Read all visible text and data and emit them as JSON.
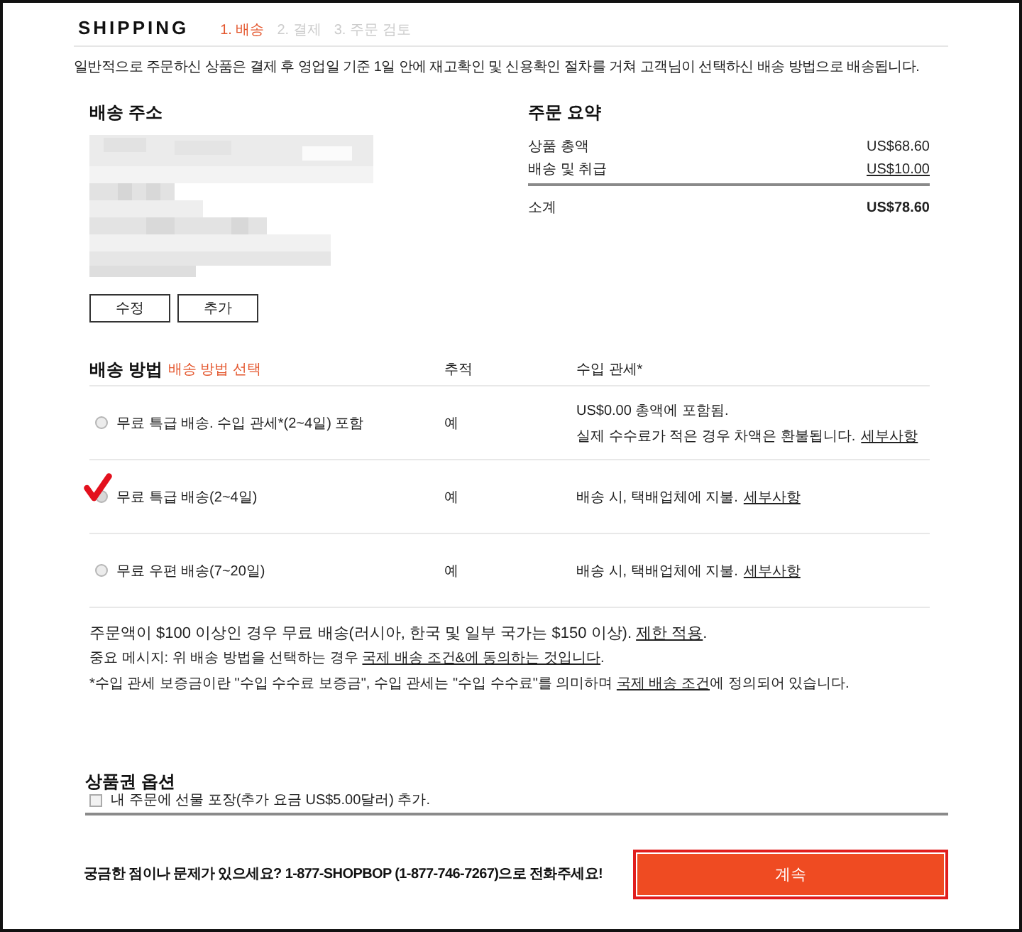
{
  "header": {
    "title": "SHIPPING",
    "steps": [
      {
        "label": "1. 배송",
        "selected": true
      },
      {
        "label": "2. 결제",
        "selected": false
      },
      {
        "label": "3. 주문 검토",
        "selected": false
      }
    ]
  },
  "intro": "일반적으로 주문하신 상품은 결제 후 영업일 기준 1일 안에 재고확인 및 신용확인 절차를 거쳐 고객님이 선택하신 배송 방법으로 배송됩니다.",
  "address": {
    "heading": "배송 주소",
    "buttons": [
      "수정",
      "추가"
    ]
  },
  "summary": {
    "heading": "주문 요약",
    "lines": [
      {
        "label": "상품 총액",
        "value": "US$68.60"
      },
      {
        "label": "배송 및 취급",
        "value": "US$10.00"
      }
    ],
    "total": {
      "label": "소계",
      "value": "US$78.60"
    }
  },
  "shipping": {
    "heading": "배송 방법",
    "hint": "배송 방법 선택",
    "columns": [
      "추적",
      "수입 관세*"
    ],
    "options": [
      {
        "label": "무료 특급 배송. 수입 관세*(2~4일) 포함",
        "tracking": "예",
        "duties": [
          "US$0.00 총액에 포함됨.",
          "실제 수수료가 적은 경우 차액은 환불됩니다."
        ],
        "link": "세부사항",
        "selected": false
      },
      {
        "label": "무료 특급 배송(2~4일)",
        "tracking": "예",
        "duties": [
          "배송 시, 택배업체에 지불."
        ],
        "link": "세부사항",
        "selected": true
      },
      {
        "label": "무료 우편 배송(7~20일)",
        "tracking": "예",
        "duties": [
          "배송 시, 택배업체에 지불."
        ],
        "link": "세부사항",
        "selected": false
      }
    ]
  },
  "free_shipping_note": {
    "before": "주문액이 $100 이상인 경우 무료 배송(러시아, 한국 및 일부 국가는 $150 이상). ",
    "link": "제한 적용",
    "after": "."
  },
  "notes": [
    {
      "before": "중요 메시지: 위 배송 방법을 선택하는 경우 ",
      "link": "국제 배송 조건&에 동의하는 것입니다",
      "after": "."
    },
    {
      "before": "*수입 관세 보증금이란 \"수입 수수료 보증금\", 수입 관세는 \"수입 수수료\"를 의미하며 ",
      "link": "국제 배송 조건",
      "after": "에 정의되어 있습니다."
    }
  ],
  "gift": {
    "heading": "상품권 옵션",
    "label": "내 주문에 선물 포장(추가 요금 US$5.00달러) 추가.",
    "checked": false
  },
  "footer": {
    "help": "궁금한 점이나 문제가 있으세요? 1-877-SHOPBOP (1-877-746-7267)으로 전화주세요!",
    "button": "계속"
  }
}
